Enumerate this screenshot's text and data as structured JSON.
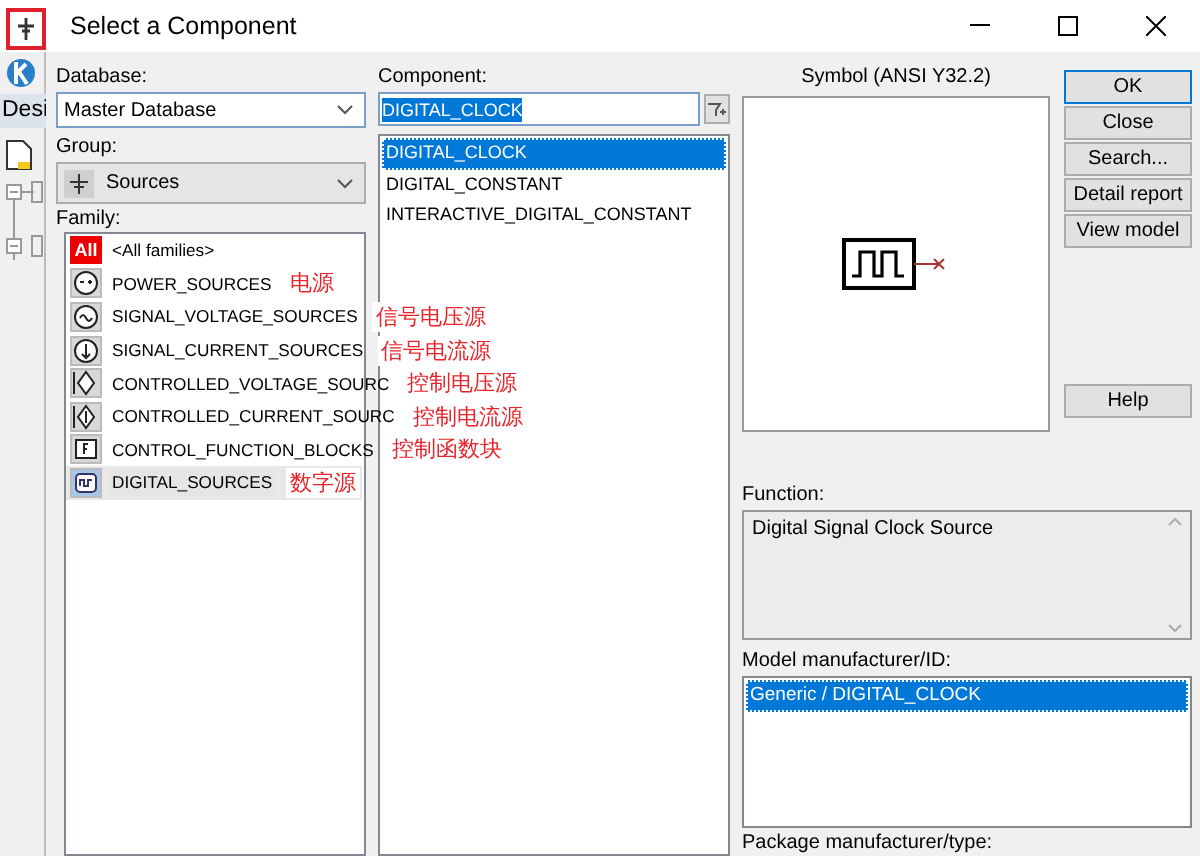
{
  "background_app": {
    "tab_label": "Desi"
  },
  "window": {
    "title": "Select a Component"
  },
  "database": {
    "label": "Database:",
    "value": "Master Database"
  },
  "group": {
    "label": "Group:",
    "value": "Sources"
  },
  "family": {
    "label": "Family:",
    "items": [
      {
        "name": "<All families>",
        "kind": "all",
        "icon_text": "All",
        "selected": false
      },
      {
        "name": "POWER_SOURCES",
        "kind": "power",
        "note": "电源",
        "selected": false
      },
      {
        "name": "SIGNAL_VOLTAGE_SOURCES",
        "kind": "signal_voltage",
        "note": "信号电压源",
        "selected": false
      },
      {
        "name": "SIGNAL_CURRENT_SOURCES",
        "kind": "signal_current",
        "note": "信号电流源",
        "selected": false
      },
      {
        "name": "CONTROLLED_VOLTAGE_SOURC",
        "kind": "controlled_voltage",
        "note": "控制电压源",
        "selected": false
      },
      {
        "name": "CONTROLLED_CURRENT_SOURC",
        "kind": "controlled_current",
        "note": "控制电流源",
        "selected": false
      },
      {
        "name": "CONTROL_FUNCTION_BLOCKS",
        "kind": "function_block",
        "note": "控制函数块",
        "selected": false
      },
      {
        "name": "DIGITAL_SOURCES",
        "kind": "digital",
        "note": "数字源",
        "selected": true
      }
    ]
  },
  "component": {
    "label": "Component:",
    "value": "DIGITAL_CLOCK",
    "items": [
      {
        "name": "DIGITAL_CLOCK",
        "selected": true
      },
      {
        "name": "DIGITAL_CONSTANT",
        "selected": false
      },
      {
        "name": "INTERACTIVE_DIGITAL_CONSTANT",
        "selected": false
      }
    ]
  },
  "symbol": {
    "label": "Symbol (ANSI Y32.2)"
  },
  "buttons": [
    {
      "label": "OK",
      "default": true
    },
    {
      "label": "Close",
      "default": false
    },
    {
      "label": "Search...",
      "default": false
    },
    {
      "label": "Detail report",
      "default": false
    },
    {
      "label": "View model",
      "default": false
    }
  ],
  "help_button": {
    "label": "Help"
  },
  "function": {
    "label": "Function:",
    "text": "Digital Signal Clock Source"
  },
  "model": {
    "label": "Model manufacturer/ID:",
    "items": [
      {
        "name": "Generic / DIGITAL_CLOCK",
        "selected": true
      }
    ]
  },
  "package": {
    "label": "Package manufacturer/type:"
  }
}
